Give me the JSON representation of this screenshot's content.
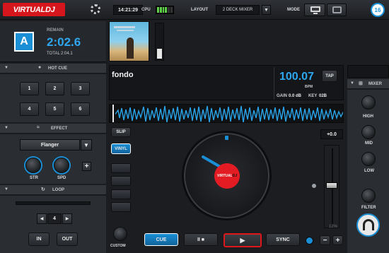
{
  "topbar": {
    "logo": "VIRTUALDJ",
    "time": "14:21:29",
    "cpu_label": "CPU",
    "layout_label": "LAYOUT",
    "layout_value": "2 DECK MIXER",
    "mode_label": "MODE",
    "badge": "16"
  },
  "deck": {
    "letter": "A",
    "remain_label": "REMAIN",
    "remain": "2:02.6",
    "total_label": "TOTAL",
    "total": "2:04.1",
    "title": "fondo",
    "bpm": "100.07",
    "bpm_label": "BPM",
    "tap": "TAP",
    "gain_label": "GAIN",
    "gain": "0.0 dB",
    "key_label": "KEY",
    "key": "02B",
    "pitch": "+0.0",
    "pitch_foot": "12%",
    "platter_logo_a": "VIRTUAL",
    "platter_logo_b": "DJ",
    "buttons": {
      "slip": "SLIP",
      "vinyl": "VINYL",
      "custom": "CUSTOM",
      "cue": "CUE",
      "pause": "II ■",
      "play": "▶",
      "sync": "SYNC"
    }
  },
  "hotcue": {
    "title": "HOT CUE",
    "pads": [
      "1",
      "2",
      "3",
      "4",
      "5",
      "6"
    ]
  },
  "effect": {
    "title": "EFFECT",
    "selected": "Flanger",
    "str": "STR",
    "spd": "SPD",
    "add": "+"
  },
  "loop": {
    "title": "LOOP",
    "size": "4",
    "in": "IN",
    "out": "OUT",
    "prev": "◀",
    "next": "▶"
  },
  "mixer": {
    "title": "MIXER",
    "knobs": [
      "HIGH",
      "MID",
      "LOW",
      "FILTER"
    ]
  },
  "colors": {
    "accent": "#1a8fd6",
    "bpm": "#2ea7f0",
    "waveform": "#2aa3e8",
    "play_border": "#e0161b",
    "logo_red": "#e31b23"
  }
}
